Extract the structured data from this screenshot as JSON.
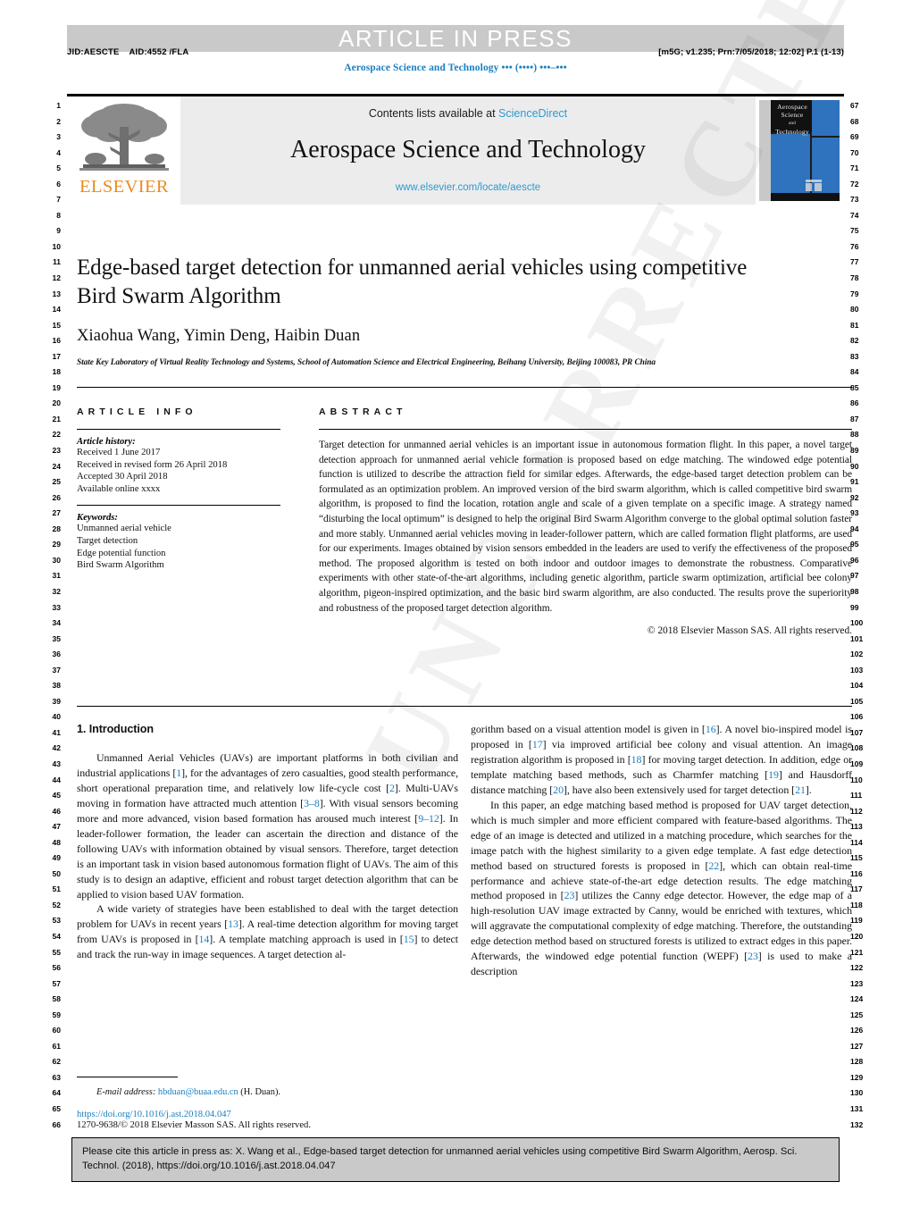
{
  "banner": {
    "article_in_press": "ARTICLE IN PRESS"
  },
  "meta": {
    "jid": "JID:AESCTE    AID:4552 /FLA",
    "prn": "[m5G; v1.235; Prn:7/05/2018; 12:02] P.1 (1-13)",
    "running_journal": "Aerospace Science and Technology ••• (••••) •••–•••"
  },
  "masthead": {
    "contents_prefix": "Contents lists available at ",
    "sciencedirect": "ScienceDirect",
    "journal_title": "Aerospace Science and Technology",
    "journal_url": "www.elsevier.com/locate/aescte",
    "publisher_logo_text": "ELSEVIER",
    "cover_title_line1": "Aerospace",
    "cover_title_line2": "Science",
    "cover_title_and": "and",
    "cover_title_line3": "Technology"
  },
  "article": {
    "title": "Edge-based target detection for unmanned aerial vehicles using competitive Bird Swarm Algorithm",
    "authors": "Xiaohua Wang, Yimin Deng, Haibin Duan",
    "affiliation": "State Key Laboratory of Virtual Reality Technology and Systems, School of Automation Science and Electrical Engineering, Beihang University, Beijing 100083, PR China"
  },
  "article_info": {
    "heading": "ARTICLE INFO",
    "history_label": "Article history:",
    "history": [
      "Received 1 June 2017",
      "Received in revised form 26 April 2018",
      "Accepted 30 April 2018",
      "Available online xxxx"
    ],
    "keywords_label": "Keywords:",
    "keywords": [
      "Unmanned aerial vehicle",
      "Target detection",
      "Edge potential function",
      "Bird Swarm Algorithm"
    ]
  },
  "abstract": {
    "heading": "ABSTRACT",
    "body": "Target detection for unmanned aerial vehicles is an important issue in autonomous formation flight. In this paper, a novel target detection approach for unmanned aerial vehicle formation is proposed based on edge matching. The windowed edge potential function is utilized to describe the attraction field for similar edges. Afterwards, the edge-based target detection problem can be formulated as an optimization problem. An improved version of the bird swarm algorithm, which is called competitive bird swarm algorithm, is proposed to find the location, rotation angle and scale of a given template on a specific image. A strategy named “disturbing the local optimum” is designed to help the original Bird Swarm Algorithm converge to the global optimal solution faster and more stably. Unmanned aerial vehicles moving in leader-follower pattern, which are called formation flight platforms, are used for our experiments. Images obtained by vision sensors embedded in the leaders are used to verify the effectiveness of the proposed method. The proposed algorithm is tested on both indoor and outdoor images to demonstrate the robustness. Comparative experiments with other state-of-the-art algorithms, including genetic algorithm, particle swarm optimization, artificial bee colony algorithm, pigeon-inspired optimization, and the basic bird swarm algorithm, are also conducted. The results prove the superiority and robustness of the proposed target detection algorithm.",
    "copyright": "© 2018 Elsevier Masson SAS. All rights reserved."
  },
  "body": {
    "section_heading": "1. Introduction",
    "left_p1_parts": [
      "Unmanned Aerial Vehicles (UAVs) are important platforms in both civilian and industrial applications [",
      "1",
      "], for the advantages of zero casualties, good stealth performance, short operational preparation time, and relatively low life-cycle cost [",
      "2",
      "]. Multi-UAVs moving in formation have attracted much attention [",
      "3–8",
      "]. With visual sensors becoming more and more advanced, vision based formation has aroused much interest [",
      "9–12",
      "]. In leader-follower formation, the leader can ascertain the direction and distance of the following UAVs with information obtained by visual sensors. Therefore, target detection is an important task in vision based autonomous formation flight of UAVs. The aim of this study is to design an adaptive, efficient and robust target detection algorithm that can be applied to vision based UAV formation."
    ],
    "left_p2_parts": [
      "A wide variety of strategies have been established to deal with the target detection problem for UAVs in recent years [",
      "13",
      "]. A real-time detection algorithm for moving target from UAVs is proposed in [",
      "14",
      "]. A template matching approach is used in [",
      "15",
      "] to detect and track the run-way in image sequences. A target detection al-"
    ],
    "right_p1_parts": [
      "gorithm based on a visual attention model is given in [",
      "16",
      "]. A novel bio-inspired model is proposed in [",
      "17",
      "] via improved artificial bee colony and visual attention. An image registration algorithm is proposed in [",
      "18",
      "] for moving target detection. In addition, edge or template matching based methods, such as Charmfer matching [",
      "19",
      "] and Hausdorff distance matching [",
      "20",
      "], have also been extensively used for target detection [",
      "21",
      "]."
    ],
    "right_p2_parts": [
      "In this paper, an edge matching based method is proposed for UAV target detection, which is much simpler and more efficient compared with feature-based algorithms. The edge of an image is detected and utilized in a matching procedure, which searches for the image patch with the highest similarity to a given edge template. A fast edge detection method based on structured forests is proposed in [",
      "22",
      "], which can obtain real-time performance and achieve state-of-the-art edge detection results. The edge matching method proposed in [",
      "23",
      "] utilizes the Canny edge detector. However, the edge map of a high-resolution UAV image extracted by Canny, would be enriched with textures, which will aggravate the computational complexity of edge matching. Therefore, the outstanding edge detection method based on structured forests is utilized to extract edges in this paper. Afterwards, the windowed edge potential function (WEPF) [",
      "23",
      "] is used to make a description"
    ]
  },
  "footnote": {
    "email_label": "E-mail address:",
    "email": "hbduan@buaa.edu.cn",
    "email_suffix": "(H. Duan).",
    "doi": "https://doi.org/10.1016/j.ast.2018.04.047",
    "issn_line": "1270-9638/© 2018 Elsevier Masson SAS. All rights reserved."
  },
  "cite_box": {
    "text": "Please cite this article in press as: X. Wang et al., Edge-based target detection for unmanned aerial vehicles using competitive Bird Swarm Algorithm, Aerosp. Sci. Technol. (2018), https://doi.org/10.1016/j.ast.2018.04.047"
  },
  "watermark": {
    "text": "UNCORRECTED PROOF"
  },
  "line_numbers": {
    "left_start": 1,
    "left_end": 66,
    "right_start": 67,
    "right_end": 132
  },
  "colors": {
    "link": "#1a7fc1",
    "sciencedirect": "#2e9ad0",
    "elsevier_orange": "#ec8b1f",
    "banner_gray": "#c9c9c9",
    "masthead_gray": "#ececec"
  }
}
